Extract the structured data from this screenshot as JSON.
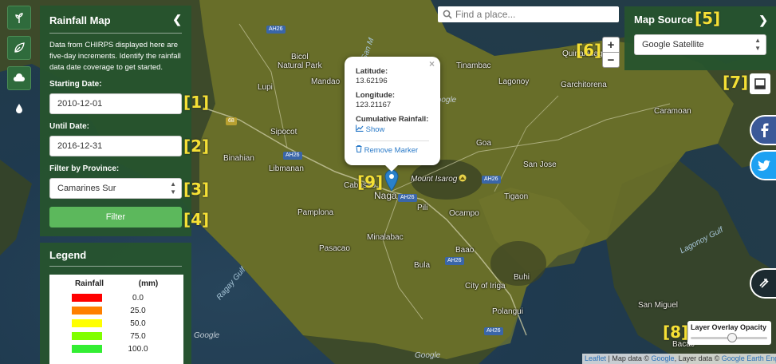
{
  "map": {
    "labels": [
      {
        "id": "bicol-natural-park",
        "text": "Bicol\nNatural Park"
      },
      {
        "id": "lupi",
        "text": "Lupi"
      },
      {
        "id": "mandao",
        "text": "Mandao"
      },
      {
        "id": "sipocot",
        "text": "Sipocot"
      },
      {
        "id": "binahian",
        "text": "Binahian"
      },
      {
        "id": "libmanan",
        "text": "Libmanan"
      },
      {
        "id": "cabusao",
        "text": "Cabusao"
      },
      {
        "id": "pamplona",
        "text": "Pamplona"
      },
      {
        "id": "pasacao",
        "text": "Pasacao"
      },
      {
        "id": "minalabac",
        "text": "Minalabac"
      },
      {
        "id": "naga",
        "text": "Naga"
      },
      {
        "id": "pili",
        "text": "Pili"
      },
      {
        "id": "ocampo",
        "text": "Ocampo"
      },
      {
        "id": "mount-isarog",
        "text": "Mount Isarog"
      },
      {
        "id": "tigaon",
        "text": "Tigaon"
      },
      {
        "id": "goa",
        "text": "Goa"
      },
      {
        "id": "san-jose",
        "text": "San Jose"
      },
      {
        "id": "lagonoy",
        "text": "Lagonoy"
      },
      {
        "id": "tinambac",
        "text": "Tinambac"
      },
      {
        "id": "garchitorena",
        "text": "Garchitorena"
      },
      {
        "id": "caramoan",
        "text": "Caramoan"
      },
      {
        "id": "quinalasag",
        "text": "Quinalasag"
      },
      {
        "id": "bula",
        "text": "Bula"
      },
      {
        "id": "baao",
        "text": "Baao"
      },
      {
        "id": "city-of-iriga",
        "text": "City of Iriga"
      },
      {
        "id": "buhi",
        "text": "Buhi"
      },
      {
        "id": "polangui",
        "text": "Polangui"
      },
      {
        "id": "san-miguel",
        "text": "San Miguel"
      },
      {
        "id": "bacacay",
        "text": "Bacac"
      },
      {
        "id": "lagonoy-gulf",
        "text": "Lagonoy Gulf"
      },
      {
        "id": "ragay-gulf",
        "text": "Ragay Gulf"
      },
      {
        "id": "san-miguel-bay",
        "text": "San M"
      }
    ],
    "road_shields": [
      "AH26",
      "AH26",
      "AH26",
      "AH26",
      "AH26",
      "AH26",
      "68"
    ],
    "watermarks": [
      "Google",
      "Google",
      "Google"
    ]
  },
  "left_panel": {
    "title": "Rainfall Map",
    "collapse_icon": "chevron-left",
    "description": "Data from CHIRPS displayed here are five-day increments. Identify the rainfall data date coverage to get started.",
    "starting_date_label": "Starting Date:",
    "starting_date_value": "2010-12-01",
    "until_date_label": "Until Date:",
    "until_date_value": "2016-12-31",
    "province_label": "Filter by Province:",
    "province_value": "Camarines Sur",
    "filter_button": "Filter"
  },
  "legend": {
    "title": "Legend",
    "col_rainfall": "Rainfall",
    "col_unit": "(mm)",
    "rows": [
      {
        "color": "#ff0000",
        "value": "0.0"
      },
      {
        "color": "#ff8000",
        "value": "25.0"
      },
      {
        "color": "#ffff00",
        "value": "50.0"
      },
      {
        "color": "#80ff00",
        "value": "75.0"
      },
      {
        "color": "#33ee33",
        "value": "100.0"
      }
    ]
  },
  "search": {
    "placeholder": "Find a place..."
  },
  "map_source": {
    "title": "Map Source",
    "value": "Google Satellite"
  },
  "zoom": {
    "in": "+",
    "out": "−"
  },
  "popup": {
    "lat_label": "Latitude:",
    "lat_value": "13.62196",
    "lng_label": "Longitude:",
    "lng_value": "123.21167",
    "rain_label": "Cumulative Rainfall:",
    "show_link": "Show",
    "remove_link": "Remove Marker",
    "close": "×"
  },
  "opacity": {
    "label": "Layer Overlay Opacity",
    "level_percent": 55
  },
  "attribution": {
    "leaflet": "Leaflet",
    "sep1": " | Map data © ",
    "google1": "Google",
    "sep2": ", Layer data © ",
    "gee": "Google Earth Engine"
  },
  "callouts": [
    "[1]",
    "[2]",
    "[3]",
    "[4]",
    "[5]",
    "[6]",
    "[7]",
    "[8]",
    "[9]"
  ],
  "colors": {
    "panel_green": "#26542e",
    "filter_green": "#5cb85c",
    "callout_yellow": "#f5e035",
    "facebook_blue": "#3b5998",
    "twitter_blue": "#1da1f2",
    "marker_blue": "#2a81cb",
    "overlay_olive": "#8c8c28"
  },
  "icons": {
    "rail": [
      "sprout-icon",
      "leaf-icon",
      "cloud-icon",
      "droplet-icon"
    ],
    "social": [
      "facebook-icon",
      "twitter-icon"
    ],
    "search": "search-icon",
    "layers": "layers-icon",
    "expand": "chevron-right-icon",
    "extra": "swap-arrows-icon"
  }
}
